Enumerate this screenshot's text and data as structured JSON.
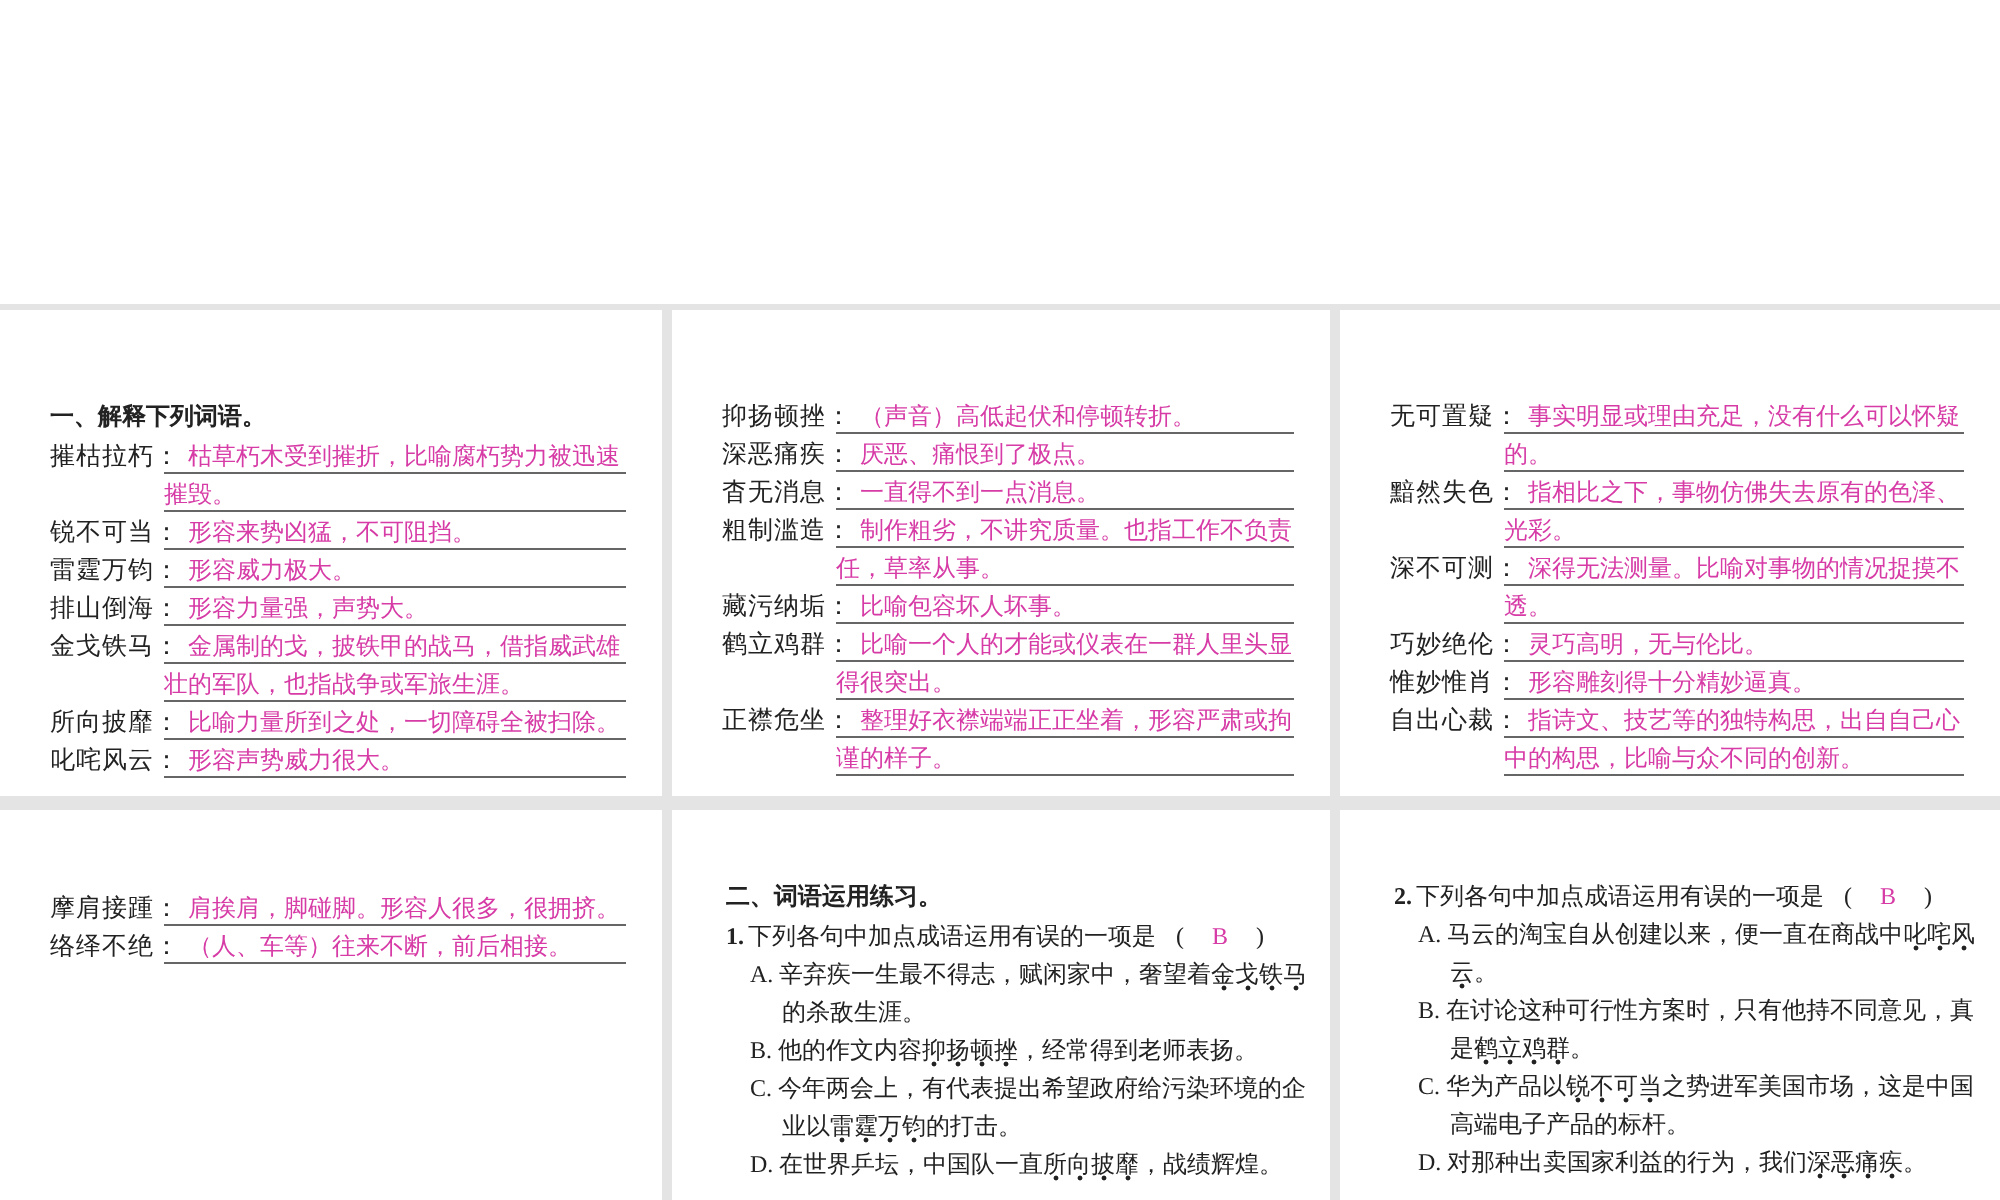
{
  "slides": [
    {
      "kind": "glossary",
      "heading": "一、解释下列词语。",
      "entries": [
        {
          "term": "摧枯拉朽：",
          "definition": "枯草朽木受到摧折，比喻腐朽势力被迅速摧毁。"
        },
        {
          "term": "锐不可当：",
          "definition": "形容来势凶猛，不可阻挡。"
        },
        {
          "term": "雷霆万钧：",
          "definition": "形容威力极大。"
        },
        {
          "term": "排山倒海：",
          "definition": "形容力量强，声势大。"
        },
        {
          "term": "金戈铁马：",
          "definition": "金属制的戈，披铁甲的战马，借指威武雄壮的军队，也指战争或军旅生涯。"
        },
        {
          "term": "所向披靡：",
          "definition": "比喻力量所到之处，一切障碍全被扫除。"
        },
        {
          "term": "叱咤风云：",
          "definition": "形容声势威力很大。"
        }
      ]
    },
    {
      "kind": "glossary",
      "entries": [
        {
          "term": "抑扬顿挫：",
          "definition": "（声音）高低起伏和停顿转折。"
        },
        {
          "term": "深恶痛疾：",
          "definition": "厌恶、痛恨到了极点。"
        },
        {
          "term": "杳无消息：",
          "definition": "一直得不到一点消息。"
        },
        {
          "term": "粗制滥造：",
          "definition": "制作粗劣，不讲究质量。也指工作不负责任，草率从事。"
        },
        {
          "term": "藏污纳垢：",
          "definition": "比喻包容坏人坏事。"
        },
        {
          "term": "鹤立鸡群：",
          "definition": "比喻一个人的才能或仪表在一群人里头显得很突出。"
        },
        {
          "term": "正襟危坐：",
          "definition": "整理好衣襟端端正正坐着，形容严肃或拘谨的样子。"
        }
      ]
    },
    {
      "kind": "glossary",
      "entries": [
        {
          "term": "无可置疑：",
          "definition": "事实明显或理由充足，没有什么可以怀疑的。"
        },
        {
          "term": "黯然失色：",
          "definition": "指相比之下，事物仿佛失去原有的色泽、光彩。"
        },
        {
          "term": "深不可测：",
          "definition": "深得无法测量。比喻对事物的情况捉摸不透。"
        },
        {
          "term": "巧妙绝伦：",
          "definition": "灵巧高明，无与伦比。"
        },
        {
          "term": "惟妙惟肖：",
          "definition": "形容雕刻得十分精妙逼真。"
        },
        {
          "term": "自出心裁：",
          "definition": "指诗文、技艺等的独特构思，出自自己心中的构思，比喻与众不同的创新。"
        }
      ]
    },
    {
      "kind": "glossary",
      "entries": [
        {
          "term": "摩肩接踵：",
          "definition": "肩挨肩，脚碰脚。形容人很多，很拥挤。"
        },
        {
          "term": "络绎不绝：",
          "definition": "（人、车等）往来不断，前后相接。"
        }
      ]
    },
    {
      "kind": "quiz",
      "heading": "二、词语运用练习。",
      "number": "1.",
      "question": "下列各句中加点成语运用有误的一项是",
      "open": "(",
      "answer": "B",
      "close": ")",
      "options": [
        {
          "label": "A.",
          "before": "辛弃疾一生最不得志，赋闲家中，奢望着",
          "emphasis": "金戈铁马",
          "after": "的杀敌生涯。"
        },
        {
          "label": "B.",
          "before": "他的作文内容",
          "emphasis": "抑扬顿挫",
          "after": "，经常得到老师表扬。"
        },
        {
          "label": "C.",
          "before": "今年两会上，有代表提出希望政府给污染环境的企业以",
          "emphasis": "雷霆万钧",
          "after": "的打击。"
        },
        {
          "label": "D.",
          "before": "在世界乒坛，中国队一直",
          "emphasis": "所向披靡",
          "after": "，战绩辉煌。"
        }
      ]
    },
    {
      "kind": "quiz",
      "number": "2.",
      "question": "下列各句中加点成语运用有误的一项是",
      "open": "(",
      "answer": "B",
      "close": ")",
      "options": [
        {
          "label": "A.",
          "before": "马云的淘宝自从创建以来，便一直在商战中",
          "emphasis": "叱咤风云",
          "after": "。"
        },
        {
          "label": "B.",
          "before": "在讨论这种可行性方案时，只有他持不同意见，真是",
          "emphasis": "鹤立鸡群",
          "after": "。"
        },
        {
          "label": "C.",
          "before": "华为产品以",
          "emphasis": "锐不可当",
          "after": "之势进军美国市场，这是中国高端电子产品的标杆。"
        },
        {
          "label": "D.",
          "before": "对那种出卖国家利益的行为，我们",
          "emphasis": "深恶痛疾",
          "after": "。"
        }
      ]
    }
  ]
}
